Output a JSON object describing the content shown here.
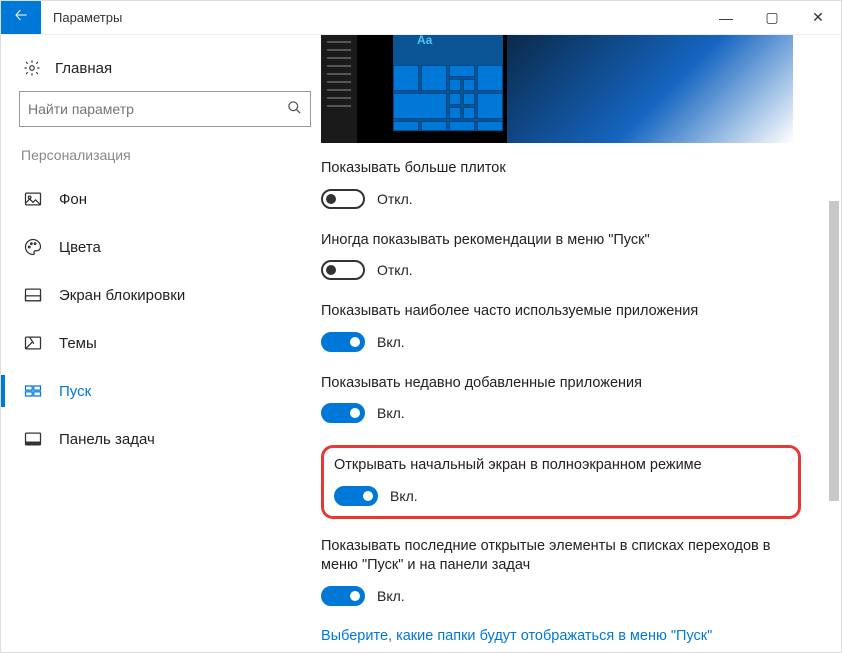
{
  "titlebar": {
    "title": "Параметры"
  },
  "sidebar": {
    "home": "Главная",
    "search_placeholder": "Найти параметр",
    "section": "Персонализация",
    "items": [
      {
        "label": "Фон"
      },
      {
        "label": "Цвета"
      },
      {
        "label": "Экран блокировки"
      },
      {
        "label": "Темы"
      },
      {
        "label": "Пуск"
      },
      {
        "label": "Панель задач"
      }
    ]
  },
  "states": {
    "on": "Вкл.",
    "off": "Откл."
  },
  "settings": [
    {
      "label": "Показывать больше плиток",
      "on": false
    },
    {
      "label": "Иногда показывать рекомендации в меню \"Пуск\"",
      "on": false
    },
    {
      "label": "Показывать наиболее часто используемые приложения",
      "on": true
    },
    {
      "label": "Показывать недавно добавленные приложения",
      "on": true
    },
    {
      "label": "Открывать начальный экран в полноэкранном режиме",
      "on": true,
      "highlighted": true
    },
    {
      "label": "Показывать последние открытые элементы в списках переходов в меню \"Пуск\" и на панели задач",
      "on": true
    }
  ],
  "link": "Выберите, какие папки будут отображаться в меню \"Пуск\""
}
